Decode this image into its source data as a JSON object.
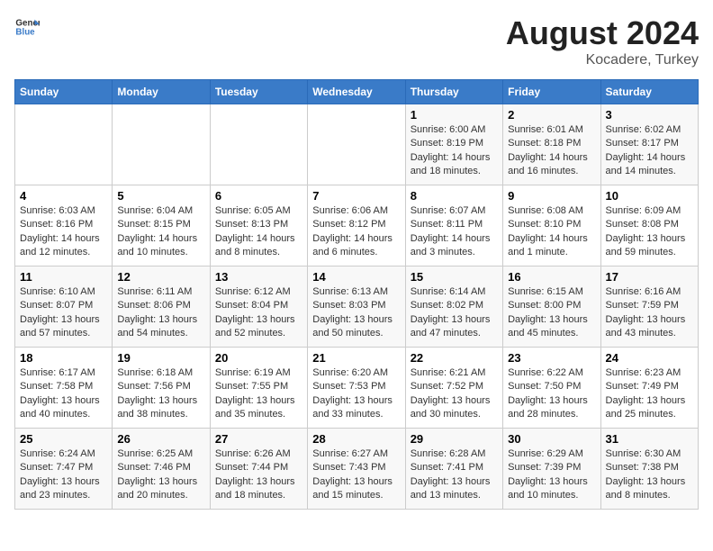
{
  "header": {
    "logo_line1": "General",
    "logo_line2": "Blue",
    "main_title": "August 2024",
    "subtitle": "Kocadere, Turkey"
  },
  "days_of_week": [
    "Sunday",
    "Monday",
    "Tuesday",
    "Wednesday",
    "Thursday",
    "Friday",
    "Saturday"
  ],
  "weeks": [
    [
      {
        "day": "",
        "info": ""
      },
      {
        "day": "",
        "info": ""
      },
      {
        "day": "",
        "info": ""
      },
      {
        "day": "",
        "info": ""
      },
      {
        "day": "1",
        "info": "Sunrise: 6:00 AM\nSunset: 8:19 PM\nDaylight: 14 hours\nand 18 minutes."
      },
      {
        "day": "2",
        "info": "Sunrise: 6:01 AM\nSunset: 8:18 PM\nDaylight: 14 hours\nand 16 minutes."
      },
      {
        "day": "3",
        "info": "Sunrise: 6:02 AM\nSunset: 8:17 PM\nDaylight: 14 hours\nand 14 minutes."
      }
    ],
    [
      {
        "day": "4",
        "info": "Sunrise: 6:03 AM\nSunset: 8:16 PM\nDaylight: 14 hours\nand 12 minutes."
      },
      {
        "day": "5",
        "info": "Sunrise: 6:04 AM\nSunset: 8:15 PM\nDaylight: 14 hours\nand 10 minutes."
      },
      {
        "day": "6",
        "info": "Sunrise: 6:05 AM\nSunset: 8:13 PM\nDaylight: 14 hours\nand 8 minutes."
      },
      {
        "day": "7",
        "info": "Sunrise: 6:06 AM\nSunset: 8:12 PM\nDaylight: 14 hours\nand 6 minutes."
      },
      {
        "day": "8",
        "info": "Sunrise: 6:07 AM\nSunset: 8:11 PM\nDaylight: 14 hours\nand 3 minutes."
      },
      {
        "day": "9",
        "info": "Sunrise: 6:08 AM\nSunset: 8:10 PM\nDaylight: 14 hours\nand 1 minute."
      },
      {
        "day": "10",
        "info": "Sunrise: 6:09 AM\nSunset: 8:08 PM\nDaylight: 13 hours\nand 59 minutes."
      }
    ],
    [
      {
        "day": "11",
        "info": "Sunrise: 6:10 AM\nSunset: 8:07 PM\nDaylight: 13 hours\nand 57 minutes."
      },
      {
        "day": "12",
        "info": "Sunrise: 6:11 AM\nSunset: 8:06 PM\nDaylight: 13 hours\nand 54 minutes."
      },
      {
        "day": "13",
        "info": "Sunrise: 6:12 AM\nSunset: 8:04 PM\nDaylight: 13 hours\nand 52 minutes."
      },
      {
        "day": "14",
        "info": "Sunrise: 6:13 AM\nSunset: 8:03 PM\nDaylight: 13 hours\nand 50 minutes."
      },
      {
        "day": "15",
        "info": "Sunrise: 6:14 AM\nSunset: 8:02 PM\nDaylight: 13 hours\nand 47 minutes."
      },
      {
        "day": "16",
        "info": "Sunrise: 6:15 AM\nSunset: 8:00 PM\nDaylight: 13 hours\nand 45 minutes."
      },
      {
        "day": "17",
        "info": "Sunrise: 6:16 AM\nSunset: 7:59 PM\nDaylight: 13 hours\nand 43 minutes."
      }
    ],
    [
      {
        "day": "18",
        "info": "Sunrise: 6:17 AM\nSunset: 7:58 PM\nDaylight: 13 hours\nand 40 minutes."
      },
      {
        "day": "19",
        "info": "Sunrise: 6:18 AM\nSunset: 7:56 PM\nDaylight: 13 hours\nand 38 minutes."
      },
      {
        "day": "20",
        "info": "Sunrise: 6:19 AM\nSunset: 7:55 PM\nDaylight: 13 hours\nand 35 minutes."
      },
      {
        "day": "21",
        "info": "Sunrise: 6:20 AM\nSunset: 7:53 PM\nDaylight: 13 hours\nand 33 minutes."
      },
      {
        "day": "22",
        "info": "Sunrise: 6:21 AM\nSunset: 7:52 PM\nDaylight: 13 hours\nand 30 minutes."
      },
      {
        "day": "23",
        "info": "Sunrise: 6:22 AM\nSunset: 7:50 PM\nDaylight: 13 hours\nand 28 minutes."
      },
      {
        "day": "24",
        "info": "Sunrise: 6:23 AM\nSunset: 7:49 PM\nDaylight: 13 hours\nand 25 minutes."
      }
    ],
    [
      {
        "day": "25",
        "info": "Sunrise: 6:24 AM\nSunset: 7:47 PM\nDaylight: 13 hours\nand 23 minutes."
      },
      {
        "day": "26",
        "info": "Sunrise: 6:25 AM\nSunset: 7:46 PM\nDaylight: 13 hours\nand 20 minutes."
      },
      {
        "day": "27",
        "info": "Sunrise: 6:26 AM\nSunset: 7:44 PM\nDaylight: 13 hours\nand 18 minutes."
      },
      {
        "day": "28",
        "info": "Sunrise: 6:27 AM\nSunset: 7:43 PM\nDaylight: 13 hours\nand 15 minutes."
      },
      {
        "day": "29",
        "info": "Sunrise: 6:28 AM\nSunset: 7:41 PM\nDaylight: 13 hours\nand 13 minutes."
      },
      {
        "day": "30",
        "info": "Sunrise: 6:29 AM\nSunset: 7:39 PM\nDaylight: 13 hours\nand 10 minutes."
      },
      {
        "day": "31",
        "info": "Sunrise: 6:30 AM\nSunset: 7:38 PM\nDaylight: 13 hours\nand 8 minutes."
      }
    ]
  ]
}
